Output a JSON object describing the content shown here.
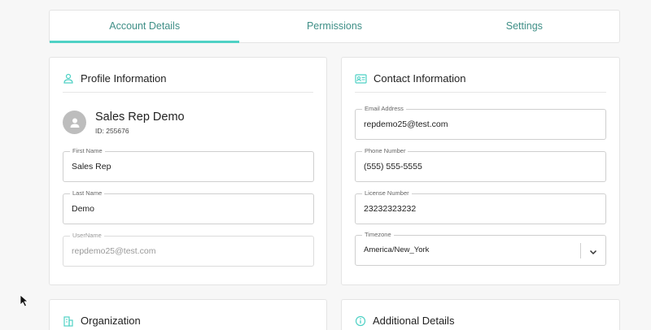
{
  "tabs": [
    {
      "label": "Account Details",
      "active": true
    },
    {
      "label": "Permissions",
      "active": false
    },
    {
      "label": "Settings",
      "active": false
    }
  ],
  "profile": {
    "title": "Profile Information",
    "icon": "person-icon",
    "name": "Sales Rep Demo",
    "id_text": "ID: 255676",
    "fields": {
      "first_name": {
        "label": "First Name",
        "value": "Sales Rep"
      },
      "last_name": {
        "label": "Last Name",
        "value": "Demo"
      },
      "username": {
        "label": "UserName",
        "value": "repdemo25@test.com"
      }
    }
  },
  "contact": {
    "title": "Contact Information",
    "icon": "contact-card-icon",
    "fields": {
      "email": {
        "label": "Email Address",
        "value": "repdemo25@test.com"
      },
      "phone": {
        "label": "Phone Number",
        "value": "(555) 555-5555"
      },
      "license": {
        "label": "License Number",
        "value": "23232323232"
      },
      "timezone": {
        "label": "Timezone",
        "value": "America/New_York"
      }
    }
  },
  "organization": {
    "title": "Organization",
    "icon": "building-icon"
  },
  "additional": {
    "title": "Additional Details",
    "icon": "info-icon"
  },
  "colors": {
    "accent": "#4fd1c5",
    "tab_text": "#3f8f87",
    "icon": "#4fd1c5"
  }
}
